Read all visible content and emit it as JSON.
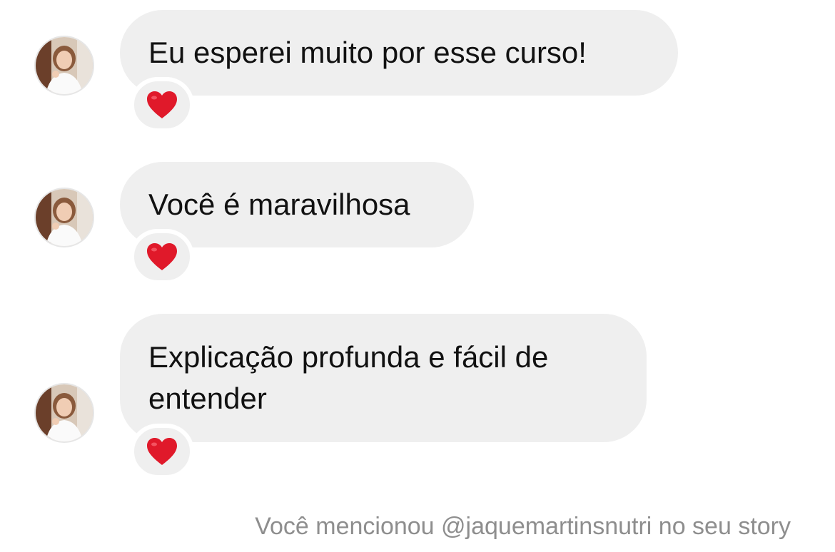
{
  "conversation": {
    "messages": [
      {
        "text": "Eu esperei muito por esse curso!",
        "reaction": "heart-icon"
      },
      {
        "text": "Você é maravilhosa",
        "reaction": "heart-icon"
      },
      {
        "text": "Explicação profunda e fácil de\nentender",
        "reaction": "heart-icon"
      }
    ],
    "mention_notice": "Você mencionou @jaquemartinsnutri no seu story"
  },
  "colors": {
    "bubble": "#efefef",
    "text": "#111111",
    "meta_text": "#8e8e8e",
    "heart": "#e0192a"
  }
}
